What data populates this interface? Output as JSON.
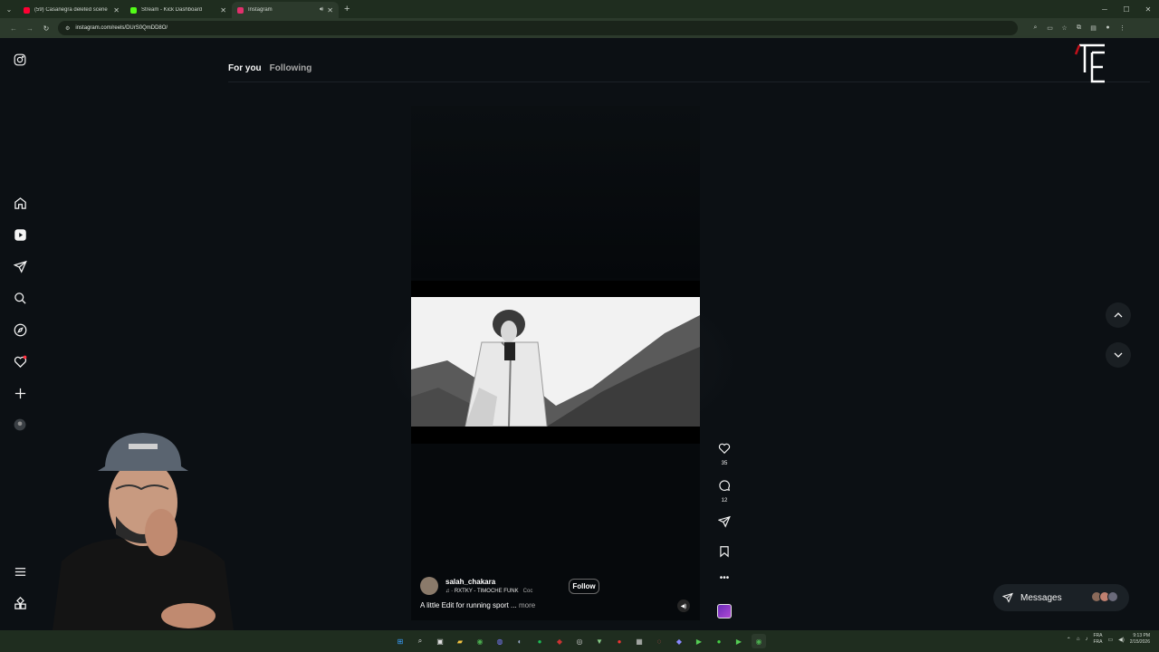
{
  "browser": {
    "tabs": [
      {
        "title": "(59) Casanegra deleted scene",
        "favicon_color": "#ff0033",
        "active": false
      },
      {
        "title": "Stream - Kick Dashboard",
        "favicon_color": "#53fc18",
        "active": false
      },
      {
        "title": "Instagram",
        "favicon_color": "#e1306c",
        "active": true
      }
    ],
    "new_tab": "+",
    "url": "instagram.com/reels/DUrS0QmDD8O/"
  },
  "instagram": {
    "feed_tabs": {
      "for_you": "For you",
      "following": "Following"
    },
    "reel": {
      "username": "salah_chakara",
      "audio": "RXTKY - TIMOCHE FUNK",
      "audio_extra": "Coc",
      "follow_label": "Follow",
      "caption": "A little Edit for running sport ...",
      "more_label": "more"
    },
    "actions": {
      "likes": "35",
      "comments": "12"
    },
    "messages_label": "Messages"
  },
  "taskbar": {
    "lang_top": "FRA",
    "lang_bottom": "FRA",
    "time": "9:13 PM",
    "date": "2/15/2026"
  },
  "icons": {
    "sidebar": [
      "instagram-logo-icon",
      "home-icon",
      "reels-icon",
      "messages-icon",
      "search-icon",
      "explore-icon",
      "notifications-icon",
      "create-icon",
      "profile-avatar"
    ],
    "actions": [
      "like-icon",
      "comment-icon",
      "share-icon",
      "save-icon",
      "more-icon",
      "audio-icon"
    ]
  }
}
